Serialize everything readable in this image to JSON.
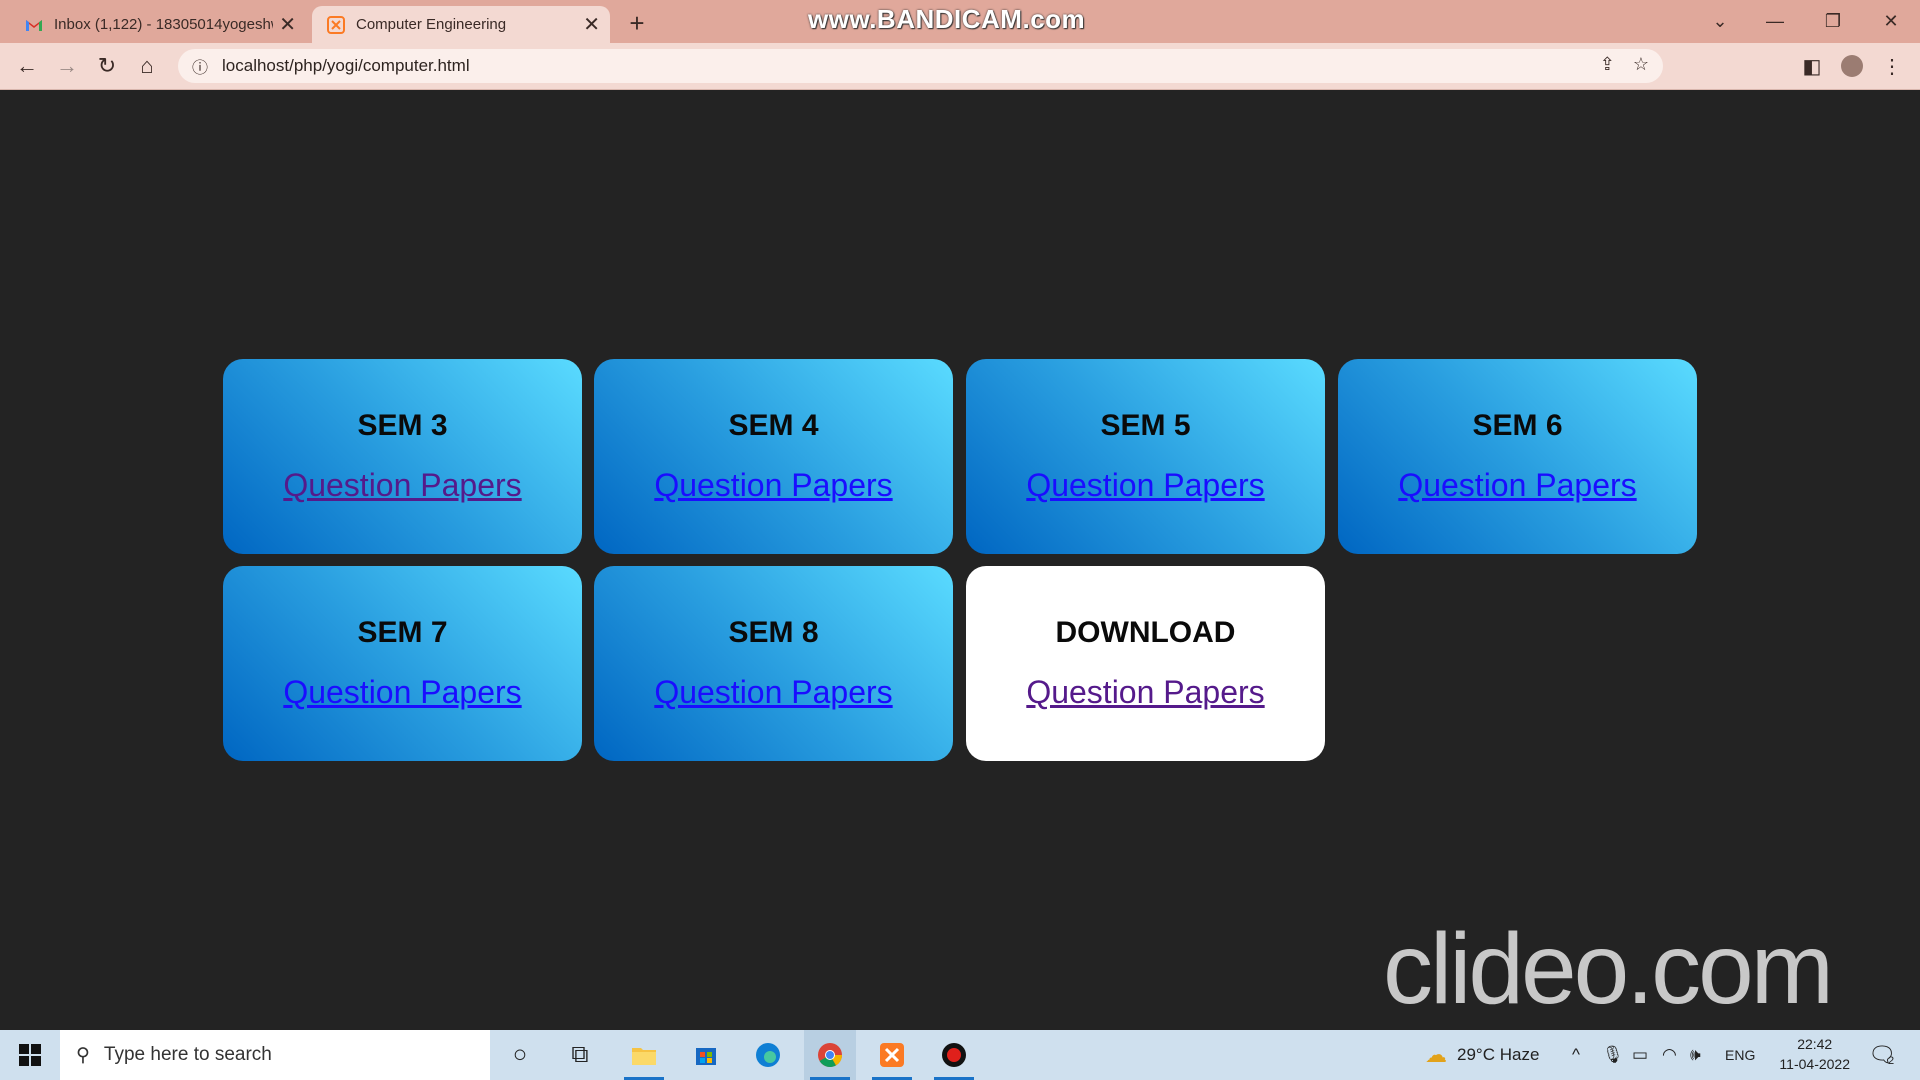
{
  "browser": {
    "tabs": [
      {
        "title": "Inbox (1,122) - 18305014yogeshw",
        "icon": "gmail-icon",
        "active": false
      },
      {
        "title": "Computer Engineering",
        "icon": "xampp-icon",
        "active": true
      }
    ],
    "url": "localhost/php/yogi/computer.html",
    "recorder_watermark": "www.BANDICAM.com"
  },
  "cards": [
    {
      "heading": "SEM 3",
      "link": "Question Papers",
      "visited": true,
      "style": "gradient"
    },
    {
      "heading": "SEM 4",
      "link": "Question Papers",
      "visited": false,
      "style": "gradient"
    },
    {
      "heading": "SEM 5",
      "link": "Question Papers",
      "visited": false,
      "style": "gradient"
    },
    {
      "heading": "SEM 6",
      "link": "Question Papers",
      "visited": false,
      "style": "gradient"
    },
    {
      "heading": "SEM 7",
      "link": "Question Papers",
      "visited": false,
      "style": "gradient"
    },
    {
      "heading": "SEM 8",
      "link": "Question Papers",
      "visited": false,
      "style": "gradient"
    },
    {
      "heading": "DOWNLOAD",
      "link": "Question Papers",
      "visited": true,
      "style": "white"
    }
  ],
  "editor_watermark": "clideo.com",
  "taskbar": {
    "search_placeholder": "Type here to search",
    "weather": "29°C  Haze",
    "language": "ENG",
    "time": "22:42",
    "date": "11-04-2022",
    "notification_count": "2"
  },
  "colors": {
    "page_bg": "#232323",
    "card_gradient_start": "#0066c2",
    "card_gradient_end": "#5adbff",
    "link": "#1a0dff",
    "link_visited": "#551a8b"
  }
}
